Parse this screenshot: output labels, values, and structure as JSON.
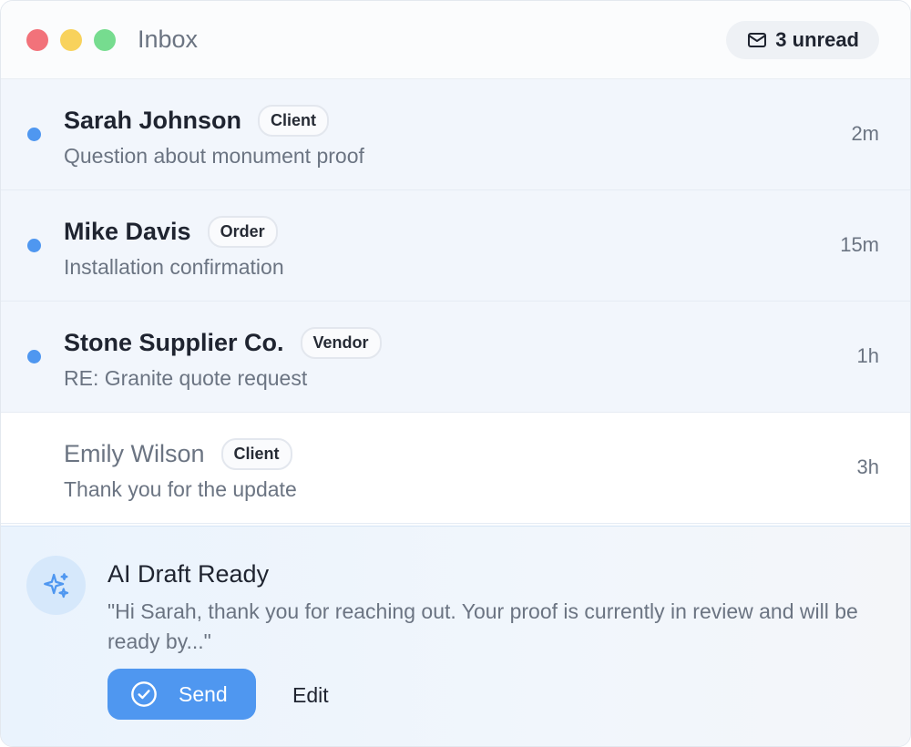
{
  "window": {
    "title": "Inbox",
    "unread_label": "3 unread"
  },
  "messages": [
    {
      "name": "Sarah Johnson",
      "tag": "Client",
      "subject": "Question about monument proof",
      "time": "2m",
      "unread": true
    },
    {
      "name": "Mike Davis",
      "tag": "Order",
      "subject": "Installation confirmation",
      "time": "15m",
      "unread": true
    },
    {
      "name": "Stone Supplier Co.",
      "tag": "Vendor",
      "subject": "RE: Granite quote request",
      "time": "1h",
      "unread": true
    },
    {
      "name": "Emily Wilson",
      "tag": "Client",
      "subject": "Thank you for the update",
      "time": "3h",
      "unread": false
    }
  ],
  "draft": {
    "title": "AI Draft Ready",
    "body": "\"Hi Sarah, thank you for reaching out. Your proof is currently in review and will be ready by...\"",
    "send_label": "Send",
    "edit_label": "Edit"
  },
  "icons": {
    "badge": "mail-icon",
    "draft": "sparkles-icon",
    "send": "check-circle-icon"
  },
  "colors": {
    "accent": "#4f97f0",
    "unread_row_bg": "#f2f6fc",
    "draft_bg": "#eaf3fd"
  }
}
